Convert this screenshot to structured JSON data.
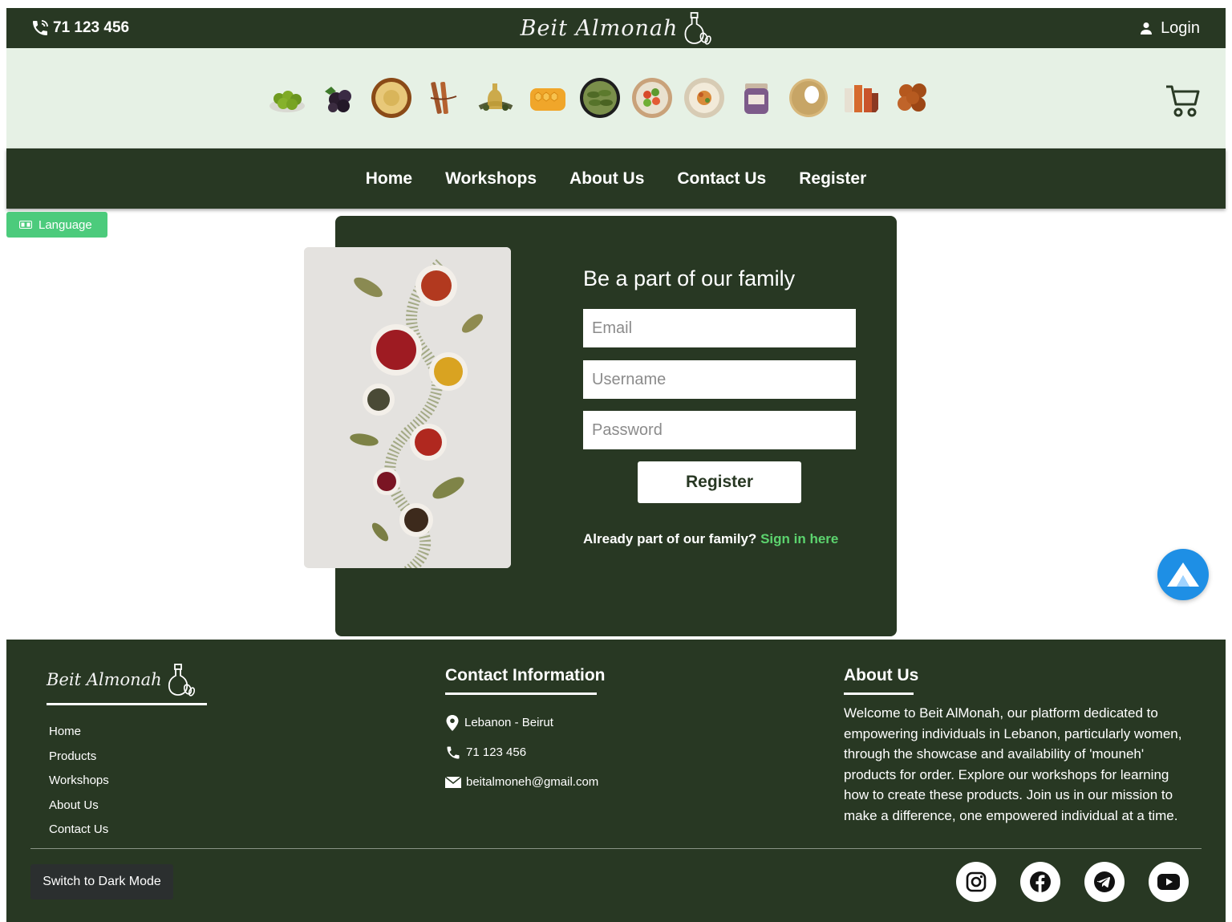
{
  "header": {
    "phone": "71 123 456",
    "brand_name": "Beit Almonah",
    "login_label": "Login"
  },
  "products_strip": {
    "items": [
      "olives-icon",
      "blackberries-icon",
      "hummus-bowl-icon",
      "cinnamon-icon",
      "olive-oil-icon",
      "honeycomb-icon",
      "stuffed-grape-leaves-icon",
      "salad-plate-icon",
      "dish-plate-icon",
      "jam-jar-icon",
      "kaak-bread-icon",
      "yarn-spools-icon",
      "falafel-icon"
    ],
    "cart_icon": "cart-icon"
  },
  "nav": {
    "items": [
      "Home",
      "Workshops",
      "About Us",
      "Contact Us",
      "Register"
    ]
  },
  "language_button": "Language",
  "register_form": {
    "title": "Be a part of our family",
    "email_placeholder": "Email",
    "username_placeholder": "Username",
    "password_placeholder": "Password",
    "submit_label": "Register",
    "already_text": "Already part of our family?",
    "signin_link": "Sign in here"
  },
  "footer": {
    "brand_name": "Beit Almonah",
    "links": [
      "Home",
      "Products",
      "Workshops",
      "About Us",
      "Contact Us"
    ],
    "contact_heading": "Contact Information",
    "contact": {
      "location": "Lebanon - Beirut",
      "phone": "71 123 456",
      "email": "beitalmoneh@gmail.com"
    },
    "about_heading": "About Us",
    "about_text": "Welcome to Beit AlMonah, our platform dedicated to empowering individuals in Lebanon, particularly women, through the showcase and availability of 'mouneh' products for order. Explore our workshops for learning how to create these products. Join us in our mission to make a difference, one empowered individual at a time.",
    "dark_mode_label": "Switch to Dark Mode",
    "socials": [
      "instagram-icon",
      "facebook-icon",
      "telegram-icon",
      "youtube-icon"
    ]
  },
  "colors": {
    "primary_dark_green": "#283823",
    "strip_light_green": "#e6f1e5",
    "language_button_green": "#4ccb7c",
    "link_green": "#5cd36e",
    "badge_blue": "#1e8fe5"
  }
}
